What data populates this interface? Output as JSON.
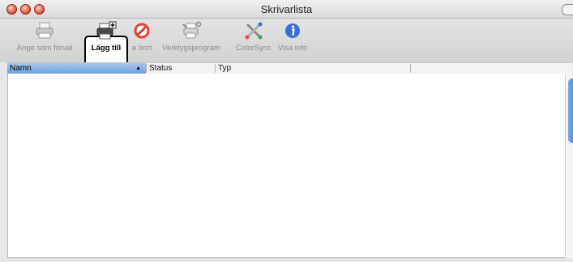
{
  "window": {
    "title": "Skrivarlista"
  },
  "toolbar": {
    "items": [
      {
        "label": "Ange som förval",
        "icon": "printer-default-icon"
      },
      {
        "label": "Lägg till",
        "icon": "add-printer-icon"
      },
      {
        "label": "a bort",
        "icon": "delete-icon"
      },
      {
        "label": "Verktygsprogram",
        "icon": "utility-icon"
      },
      {
        "label": "ColorSync",
        "icon": "colorsync-icon"
      },
      {
        "label": "Visa info",
        "icon": "info-icon"
      }
    ]
  },
  "table": {
    "columns": [
      {
        "label": "Namn",
        "sort": "▲"
      },
      {
        "label": "Status"
      },
      {
        "label": "Typ"
      }
    ],
    "rows": []
  },
  "colors": {
    "selected_column": "#6f9fdc",
    "close_button": "#d8492f",
    "info_icon": "#3b6ed8",
    "delete_icon": "#e0413b"
  }
}
